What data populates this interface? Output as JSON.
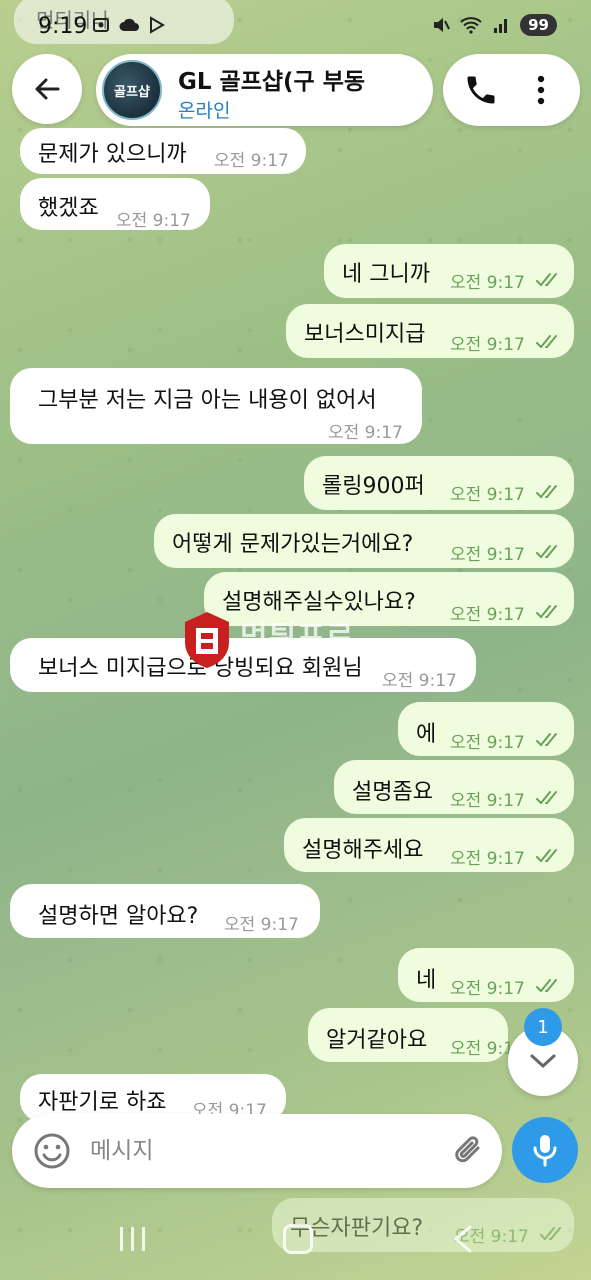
{
  "status": {
    "time": "9:19",
    "battery": "99"
  },
  "ghost_top": "먼티리나",
  "header": {
    "title": "GL 골프샵(구 부동",
    "subtitle": "온라인",
    "avatar_text": "골프샵"
  },
  "messages": [
    {
      "dir": "in",
      "text": "문제가 있으니까",
      "time": "오전 9:17"
    },
    {
      "dir": "in",
      "text": "했겠죠",
      "time": "오전 9:17"
    },
    {
      "dir": "out",
      "text": "네 그니까",
      "time": "오전 9:17"
    },
    {
      "dir": "out",
      "text": "보너스미지급",
      "time": "오전 9:17"
    },
    {
      "dir": "in",
      "text": "그부분 저는 지금 아는 내용이 없어서",
      "time": "오전 9:17"
    },
    {
      "dir": "out",
      "text": "롤링900퍼",
      "time": "오전 9:17"
    },
    {
      "dir": "out",
      "text": "어떻게 문제가있는거에요?",
      "time": "오전 9:17"
    },
    {
      "dir": "out",
      "text": "설명해주실수있나요?",
      "time": "오전 9:17"
    },
    {
      "dir": "in",
      "text": "보너스 미지급으로 낭빙되요 회원님",
      "time": "오전 9:17"
    },
    {
      "dir": "out",
      "text": "에",
      "time": "오전 9:17"
    },
    {
      "dir": "out",
      "text": "설명좀요",
      "time": "오전 9:17"
    },
    {
      "dir": "out",
      "text": "설명해주세요",
      "time": "오전 9:17"
    },
    {
      "dir": "in",
      "text": "설명하면 알아요?",
      "time": "오전 9:17"
    },
    {
      "dir": "out",
      "text": "네",
      "time": "오전 9:17"
    },
    {
      "dir": "out",
      "text": "알거같아요",
      "time": "오전 9:1"
    },
    {
      "dir": "in",
      "text": "자판기로 하죠",
      "time": "오전 9:17"
    },
    {
      "dir": "out",
      "text": "무슨자판기요?",
      "time": "오전 9:17"
    }
  ],
  "watermark": "먹튀프로",
  "unread_count": "1",
  "composer": {
    "placeholder": "메시지"
  },
  "colors": {
    "accent": "#2f9ae8",
    "outgoing": "#effdde",
    "incoming": "#ffffff",
    "tick": "#6aa15a"
  }
}
